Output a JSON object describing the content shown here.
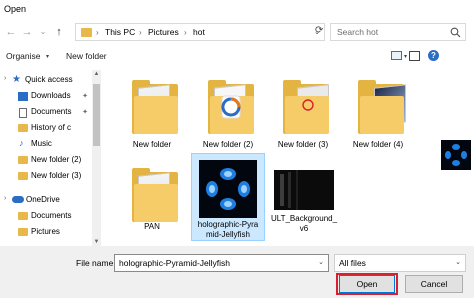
{
  "window": {
    "title": "Open"
  },
  "nav_buttons": {
    "back": "←",
    "forward": "→",
    "recent": "⌄",
    "up": "↑"
  },
  "address": {
    "segments": [
      "This PC",
      "Pictures",
      "hot"
    ],
    "separator": "›",
    "dropdown": "⌄",
    "refresh": "⟳"
  },
  "search": {
    "placeholder": "Search hot"
  },
  "toolbar": {
    "organise": "Organise",
    "organise_arrow": "▾",
    "new_folder": "New folder",
    "view_arrow": "▾",
    "help": "?"
  },
  "sidebar": {
    "items": [
      {
        "label": "Quick access",
        "icon": "star-icon",
        "pinned": false
      },
      {
        "label": "Downloads",
        "icon": "download-icon",
        "pinned": true
      },
      {
        "label": "Documents",
        "icon": "document-icon",
        "pinned": true
      },
      {
        "label": "History of c",
        "icon": "folder-icon",
        "pinned": false
      },
      {
        "label": "Music",
        "icon": "music-icon",
        "pinned": false
      },
      {
        "label": "New folder (2)",
        "icon": "folder-icon",
        "pinned": false
      },
      {
        "label": "New folder (3)",
        "icon": "folder-icon",
        "pinned": false
      },
      {
        "label": "OneDrive",
        "icon": "cloud-icon",
        "pinned": false
      },
      {
        "label": "Documents",
        "icon": "folder-icon",
        "pinned": false
      },
      {
        "label": "Pictures",
        "icon": "folder-icon",
        "pinned": false
      }
    ],
    "pin_glyph": "✦",
    "expander": "›"
  },
  "files": [
    {
      "name": "New folder",
      "kind": "folder"
    },
    {
      "name": "New folder (2)",
      "kind": "folder"
    },
    {
      "name": "New folder (3)",
      "kind": "folder"
    },
    {
      "name": "New folder (4)",
      "kind": "folder"
    },
    {
      "name": "PAN",
      "kind": "folder"
    },
    {
      "name_line1": "holographic-Pyra",
      "name_line2": "mid-Jellyfish",
      "kind": "image",
      "selected": true
    },
    {
      "name_line1": "ULT_Background_",
      "name_line2": "v6",
      "kind": "image"
    }
  ],
  "bottom": {
    "file_name_label": "File name:",
    "file_name_value": "holographic-Pyramid-Jellyfish",
    "file_type": "All files",
    "dropdown": "⌄",
    "open": "Open",
    "cancel": "Cancel"
  },
  "colors": {
    "accent": "#0078d7",
    "highlight": "#d9202f",
    "selection": "#cce8ff",
    "folder": "#e4b443"
  }
}
